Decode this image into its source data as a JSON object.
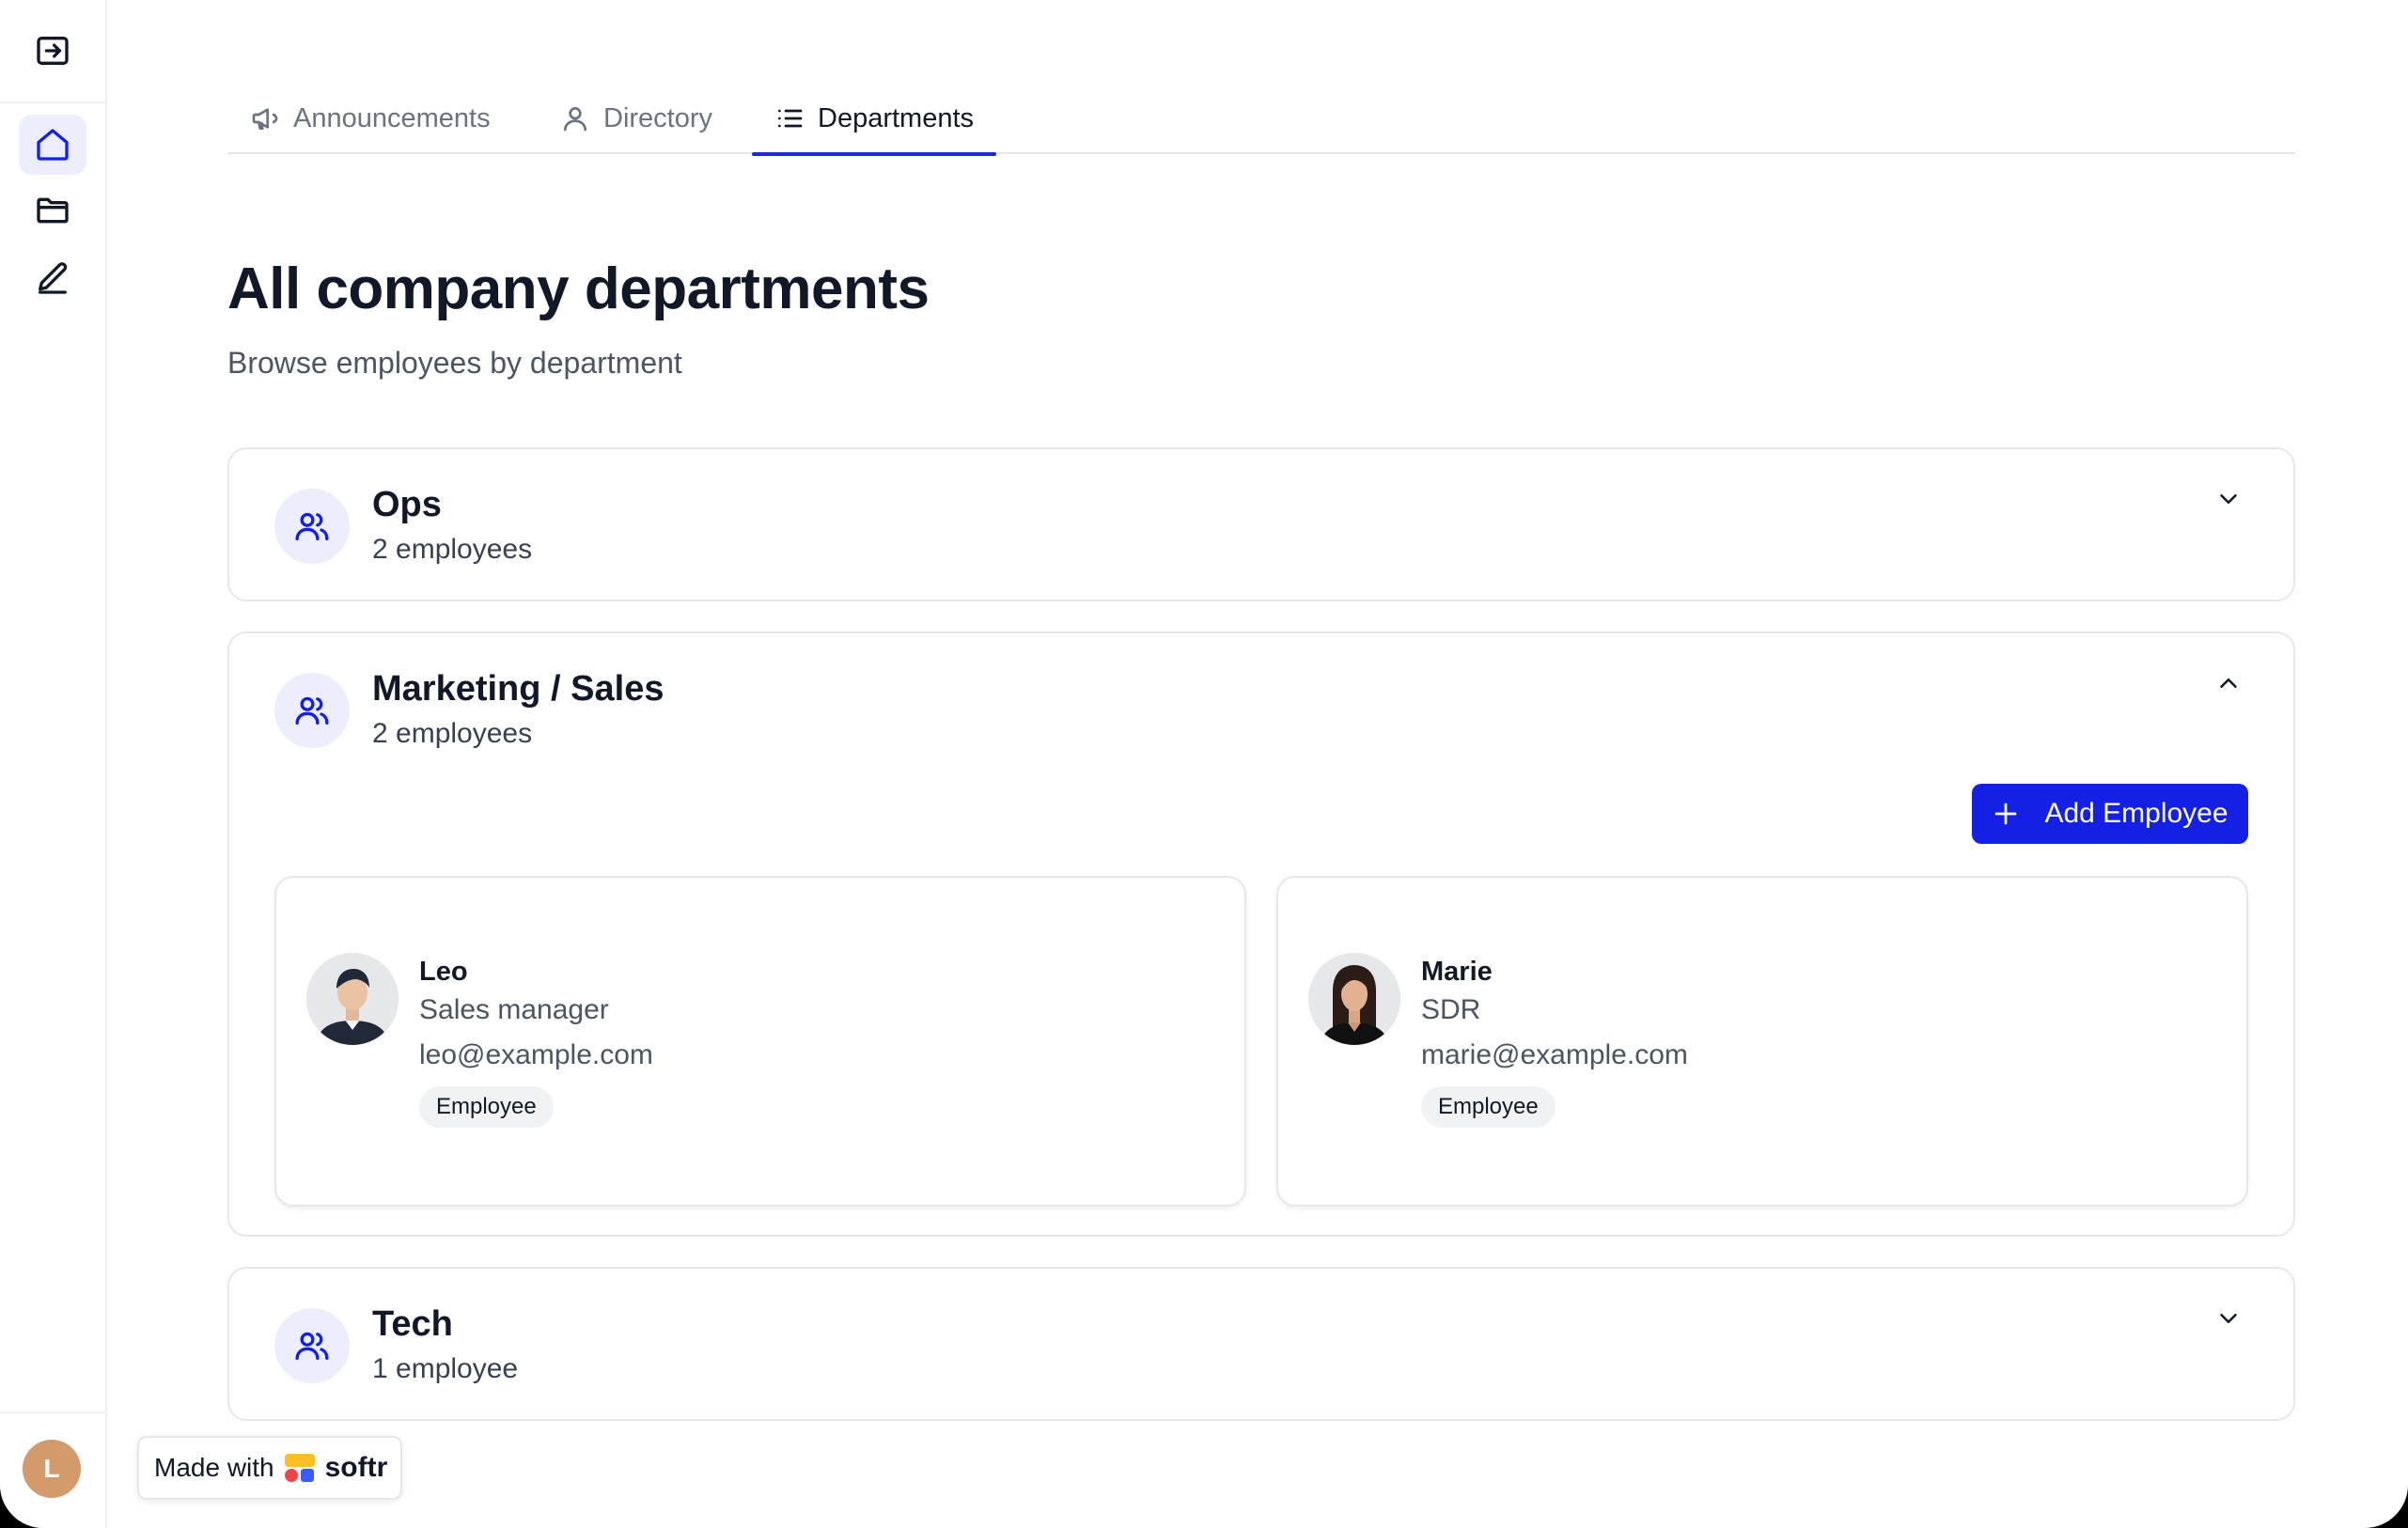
{
  "sidebar": {
    "items": [
      {
        "name": "collapse",
        "icon": "arrow-right-square-icon"
      },
      {
        "name": "home",
        "icon": "home-icon",
        "active": true
      },
      {
        "name": "folder",
        "icon": "folder-icon"
      },
      {
        "name": "pen",
        "icon": "pen-icon"
      }
    ],
    "user_initial": "L",
    "avatar_color": "#d39a6b"
  },
  "tabs": [
    {
      "label": "Announcements",
      "icon": "megaphone-icon",
      "active": false
    },
    {
      "label": "Directory",
      "icon": "user-icon",
      "active": false
    },
    {
      "label": "Departments",
      "icon": "list-icon",
      "active": true
    }
  ],
  "page": {
    "title": "All company departments",
    "subtitle": "Browse employees by department"
  },
  "departments": [
    {
      "name": "Ops",
      "count": "2 employees",
      "expanded": false
    },
    {
      "name": "Marketing / Sales",
      "count": "2 employees",
      "expanded": true,
      "add_button": "Add Employee",
      "employees": [
        {
          "name": "Leo",
          "role": "Sales manager",
          "email": "leo@example.com",
          "tag": "Employee"
        },
        {
          "name": "Marie",
          "role": "SDR",
          "email": "marie@example.com",
          "tag": "Employee"
        }
      ]
    },
    {
      "name": "Tech",
      "count": "1 employee",
      "expanded": false
    }
  ],
  "badge": {
    "prefix": "Made with",
    "brand": "softr"
  },
  "colors": {
    "accent": "#1420e6",
    "icon_bg": "#eceefe",
    "tab_underline": "#1d28d8"
  }
}
